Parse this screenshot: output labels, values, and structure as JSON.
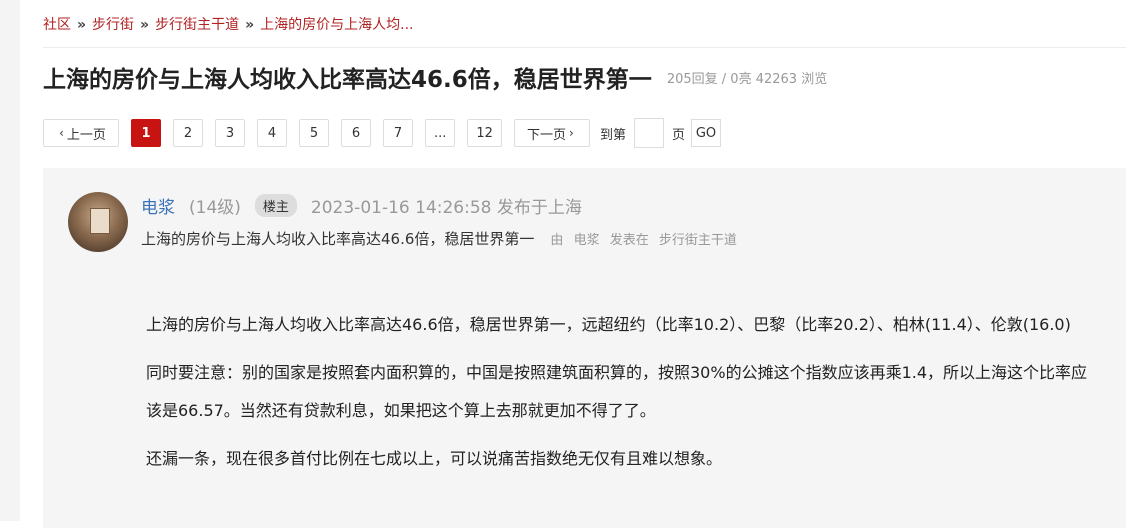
{
  "breadcrumb": {
    "items": [
      "社区",
      "步行街",
      "步行街主干道",
      "上海的房价与上海人均..."
    ],
    "separator": "»"
  },
  "thread": {
    "title": "上海的房价与上海人均收入比率高达46.6倍，稳居世界第一",
    "stats": "205回复 / 0亮 42263 浏览"
  },
  "pagination": {
    "prev": "上一页",
    "pages": [
      "1",
      "2",
      "3",
      "4",
      "5",
      "6",
      "7",
      "...",
      "12"
    ],
    "next": "下一页",
    "goto_label": "到第",
    "page_label": "页",
    "go": "GO",
    "active_color": "#c81313"
  },
  "post": {
    "author": "电浆",
    "level": "(14级)",
    "badge": "楼主",
    "time": "2023-01-16 14:26:58 发布于上海",
    "subtitle": "上海的房价与上海人均收入比率高达46.6倍，稳居世界第一",
    "via_prefix": "由",
    "via_author": "电浆",
    "via_posted": "发表在",
    "via_board": "步行街主干道",
    "paragraphs": [
      "上海的房价与上海人均收入比率高达46.6倍，稳居世界第一，远超纽约（比率10.2）、巴黎（比率20.2）、柏林(11.4）、伦敦(16.0)",
      "同时要注意：别的国家是按照套内面积算的，中国是按照建筑面积算的，按照30%的公摊这个指数应该再乘1.4，所以上海这个比率应该是66.57。当然还有贷款利息，如果把这个算上去那就更加不得了了。",
      "还漏一条，现在很多首付比例在七成以上，可以说痛苦指数绝无仅有且难以想象。"
    ],
    "author_color": "#3b73b9"
  }
}
